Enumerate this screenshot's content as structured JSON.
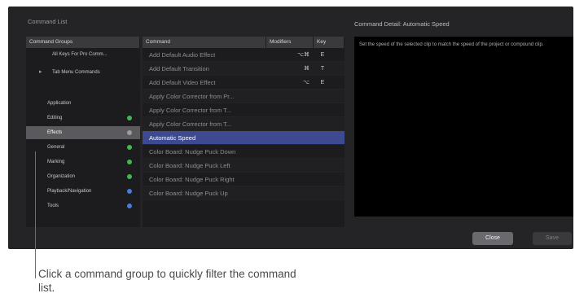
{
  "window": {
    "title": "Command List",
    "detail_title": "Command Detail: Automatic Speed",
    "detail_text": "Set the speed of the selected clip to match the speed of the project or compound clip."
  },
  "groups": {
    "header": "Command Groups",
    "items": [
      {
        "label": "All Keys For Pro Comm..."
      },
      {
        "label": "Tab Menu Commands"
      },
      {
        "label": "Application",
        "dot": ""
      },
      {
        "label": "Editing",
        "dot": "#3fb950"
      },
      {
        "label": "Effects",
        "dot": "#9c9ca0"
      },
      {
        "label": "General",
        "dot": "#3fb950"
      },
      {
        "label": "Marking",
        "dot": "#3fb950"
      },
      {
        "label": "Organization",
        "dot": "#3fb950"
      },
      {
        "label": "Playback/Navigation",
        "dot": "#4a7bd8"
      },
      {
        "label": "Tools",
        "dot": "#4a7bd8"
      }
    ]
  },
  "commands": {
    "headers": {
      "command": "Command",
      "modifiers": "Modifiers",
      "key": "Key"
    },
    "rows": [
      {
        "command": "Add Default Audio Effect",
        "modifiers": "⌥⌘",
        "key": "E"
      },
      {
        "command": "Add Default Transition",
        "modifiers": "⌘",
        "key": "T"
      },
      {
        "command": "Add Default Video Effect",
        "modifiers": "⌥",
        "key": "E"
      },
      {
        "command": "Apply Color Corrector from Pr...",
        "modifiers": "",
        "key": ""
      },
      {
        "command": "Apply Color Corrector from T...",
        "modifiers": "",
        "key": ""
      },
      {
        "command": "Apply Color Corrector from T...",
        "modifiers": "",
        "key": ""
      },
      {
        "command": "Automatic Speed",
        "modifiers": "",
        "key": ""
      },
      {
        "command": "Color Board: Nudge Puck Down",
        "modifiers": "",
        "key": ""
      },
      {
        "command": "Color Board: Nudge Puck Left",
        "modifiers": "",
        "key": ""
      },
      {
        "command": "Color Board: Nudge Puck Right",
        "modifiers": "",
        "key": ""
      },
      {
        "command": "Color Board: Nudge Puck Up",
        "modifiers": "",
        "key": ""
      }
    ],
    "selected_index": 6
  },
  "buttons": {
    "close": "Close",
    "save": "Save"
  },
  "callout": "Click a command group to quickly filter the command list."
}
